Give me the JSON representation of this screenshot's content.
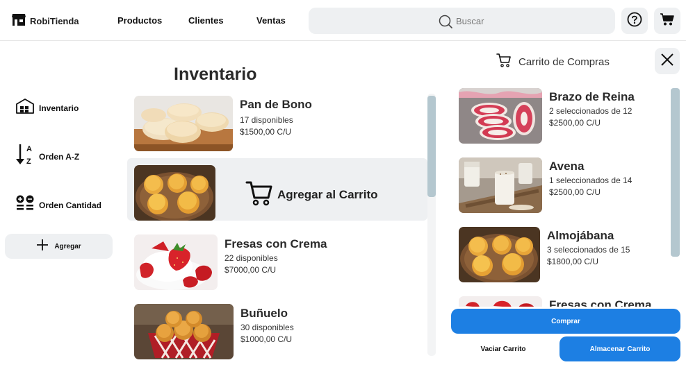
{
  "header": {
    "brand": "RobiTienda",
    "nav": [
      "Productos",
      "Clientes",
      "Ventas"
    ],
    "search_placeholder": "Buscar",
    "help_icon": "help-circle-icon",
    "cart_icon": "shopping-cart-icon"
  },
  "sidebar": {
    "items": [
      {
        "label": "Inventario",
        "icon": "warehouse-icon"
      },
      {
        "label": "Orden A-Z",
        "icon": "sort-az-icon"
      },
      {
        "label": "Orden Cantidad",
        "icon": "sort-quantity-icon"
      }
    ],
    "add_label": "Agregar"
  },
  "inventory": {
    "title": "Inventario",
    "add_to_cart_label": "Agregar al Carrito",
    "products": [
      {
        "name": "Pan de Bono",
        "available": "17 disponibles",
        "price": "$1500,00 C/U"
      },
      {
        "name": "",
        "available": "",
        "price": ""
      },
      {
        "name": "Fresas con Crema",
        "available": "22 disponibles",
        "price": "$7000,00 C/U"
      },
      {
        "name": "Buñuelo",
        "available": "30 disponibles",
        "price": "$1000,00 C/U"
      }
    ]
  },
  "cart": {
    "title": "Carrito de Compras",
    "items": [
      {
        "name": "Brazo de Reina",
        "selected": "2 seleccionados de 12",
        "price": "$2500,00 C/U"
      },
      {
        "name": "Avena",
        "selected": "1 seleccionados de 14",
        "price": "$2500,00 C/U"
      },
      {
        "name": "Almojábana",
        "selected": "3 seleccionados de 15",
        "price": "$1800,00 C/U"
      },
      {
        "name": "Fresas con Crema",
        "selected": "",
        "price": ""
      }
    ],
    "buy_label": "Comprar",
    "empty_label": "Vaciar Carrito",
    "store_label": "Almacenar Carrito"
  },
  "colors": {
    "accent": "#1d7fe3",
    "panel": "#eef0f2",
    "scroll_thumb": "#b4c7cf"
  }
}
